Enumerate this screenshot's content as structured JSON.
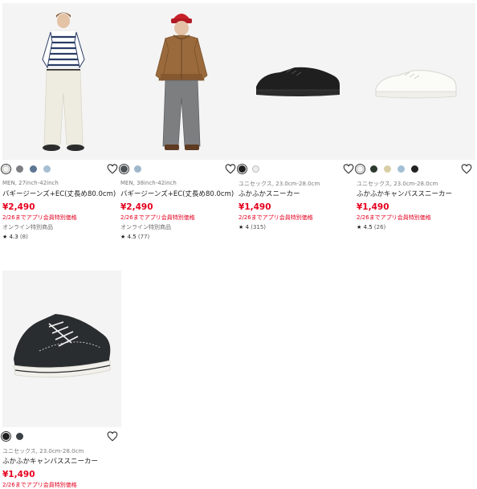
{
  "products": [
    {
      "meta": "MEN, 27inch-42inch",
      "name": "バギージーンズ+EC(丈長め80.0cm)",
      "price": "¥2,490",
      "promo": "2/26までアプリ会員特別価格",
      "online": "オンライン特別商品",
      "rating": "4.3",
      "count": "(8)",
      "swatches": [
        "#f2f2ef",
        "#7d7f82",
        "#5c7794",
        "#a6bfd4"
      ]
    },
    {
      "meta": "MEN, 38inch-42inch",
      "name": "バギージーンズ+EC(丈長め80.0cm)",
      "price": "¥2,490",
      "promo": "2/26までアプリ会員特別価格",
      "online": "オンライン特別商品",
      "rating": "4.5",
      "count": "(77)",
      "swatches": [
        "#4d5257",
        "#9fb7cb"
      ]
    },
    {
      "meta": "ユニセックス, 23.0cm-28.0cm",
      "name": "ふかふかスニーカー",
      "price": "¥1,490",
      "promo": "2/26までアプリ会員特別価格",
      "online": "",
      "rating": "4",
      "count": "(315)",
      "swatches": [
        "#1f1f1f",
        "#ededed"
      ]
    },
    {
      "meta": "ユニセックス, 23.0cm-28.0cm",
      "name": "ふかふかキャンバススニーカー",
      "price": "¥1,490",
      "promo": "2/26までアプリ会員特別価格",
      "online": "",
      "rating": "4.5",
      "count": "(26)",
      "swatches": [
        "#f4f4f0",
        "#2c3a2e",
        "#d9cfa6",
        "#a3c0d6",
        "#222222"
      ]
    },
    {
      "meta": "ユニセックス, 23.0cm-28.0cm",
      "name": "ふかふかキャンバススニーカー",
      "price": "¥1,490",
      "promo": "2/26までアプリ会員特別価格",
      "online": "",
      "rating": "",
      "count": "",
      "swatches": [
        "#1f1f1f",
        "#3b4047"
      ]
    }
  ],
  "colors": {
    "accent_red": "#e5001e",
    "image_bg": "#f4f4f4"
  }
}
